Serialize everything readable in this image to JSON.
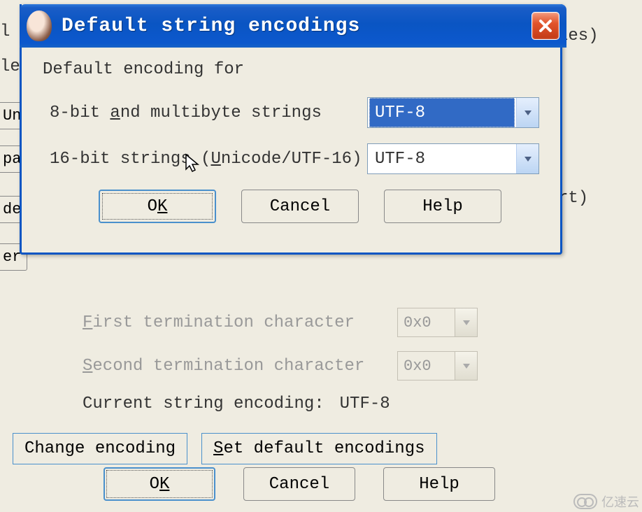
{
  "dialog": {
    "title": "Default string encodings",
    "heading": "Default encoding for",
    "row1_label_pre": "8-bit ",
    "row1_label_u": "a",
    "row1_label_post": "nd multibyte strings",
    "row1_value": "UTF-8",
    "row2_label_pre": "16-bit strings (",
    "row2_label_u": "U",
    "row2_label_post": "nicode/UTF-16)",
    "row2_value": "UTF-8",
    "ok_pre": "O",
    "ok_u": "K",
    "cancel": "Cancel",
    "help": "Help"
  },
  "bg": {
    "text_right1": "les)",
    "text_right2": "rt)",
    "left_label1": "l",
    "left_label2": "le",
    "left_btn1": "Un",
    "left_btn2": "pa",
    "left_btn3": "de",
    "left_btn4": "er",
    "first_pre": "F",
    "first_post": "irst termination character",
    "first_val": "0x0",
    "second_pre": "S",
    "second_post": "econd termination character",
    "second_val": "0x0",
    "current_label": "Current string encoding:",
    "current_value": "UTF-8",
    "change_btn": "Change encoding",
    "setdef_btn_pre": "S",
    "setdef_btn_post": "et default encodings",
    "ok_pre": "O",
    "ok_u": "K",
    "cancel": "Cancel",
    "help": "Help"
  },
  "watermark": "亿速云"
}
